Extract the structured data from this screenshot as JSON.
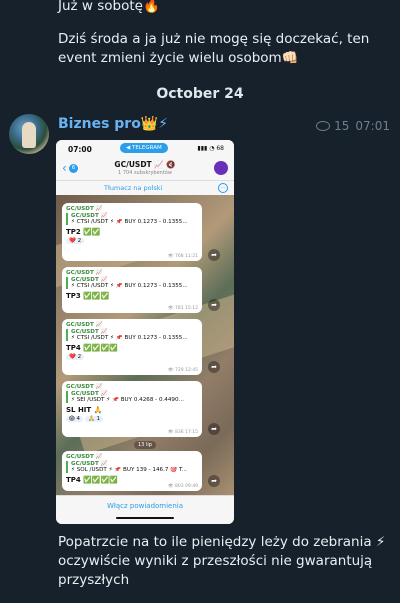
{
  "previous_message": {
    "line1": "Już w sobotę🔥",
    "line2": "Dziś środa a ja już nie mogę się doczekać, ten event zmieni życie wielu osobom👊🏻"
  },
  "date_separator": "October 24",
  "post": {
    "sender": "Biznes pro👑⚡",
    "views": "15",
    "time": "07:01",
    "caption": "Popatrzcie na to ile pieniędzy leży do zebrania ⚡ oczywiście wyniki z przeszłości nie gwarantują przyszłych"
  },
  "screenshot": {
    "status_time": "07:00",
    "telegram_pill": "◀ TELEGRAM",
    "status_icons": "▮▮▮ ◔ 68",
    "back_count": "6",
    "channel_title": "GC/USDT 📈 🔇",
    "channel_subs": "1 704 subskrybentów",
    "translate": "Tłumacz na polski",
    "mute_button": "Włącz powiadomienia",
    "messages": [
      {
        "channel": "GC/USDT 📈",
        "quote_title": "GC/USDT 📈",
        "quote": "⚡ CTSI /USDT ⚡ 📌 BUY 0.1273 - 0.1355...",
        "result": "TP2 ✅✅",
        "reactions": [
          "❤️ 2"
        ],
        "time": "👁 768 11:21"
      },
      {
        "channel": "GC/USDT 📈",
        "quote_title": "GC/USDT 📈",
        "quote": "⚡ CTSI /USDT ⚡ 📌 BUY 0.1273 - 0.1355...",
        "result": "TP3 ✅✅✅",
        "reactions": [],
        "time": "👁 781 15:12"
      },
      {
        "channel": "GC/USDT 📈",
        "quote_title": "GC/USDT 📈",
        "quote": "⚡ CTSI /USDT ⚡ 📌 BUY 0.1273 - 0.1355...",
        "result": "TP4 ✅✅✅✅",
        "reactions": [
          "❤️ 2"
        ],
        "time": "👁 729 12:45"
      },
      {
        "channel": "GC/USDT 📈",
        "quote_title": "GC/USDT 📈",
        "quote": "⚡ SEI /USDT ⚡ 📌 BUY 0.4268 - 0.4490...",
        "result": "SL HIT 🙏",
        "reactions": [
          "😱 4",
          "🙏 1"
        ],
        "time": "👁 836 17:15"
      },
      {
        "channel": "GC/USDT 📈",
        "quote_title": "GC/USDT 📈",
        "quote": "⚡ SOL /USDT ⚡ 📌 BUY 139 - 146.7 🎯 T...",
        "result": "TP4 ✅✅✅✅",
        "reactions": [],
        "time": "👁 803 09:49"
      }
    ],
    "date_chip": "13 lip"
  }
}
